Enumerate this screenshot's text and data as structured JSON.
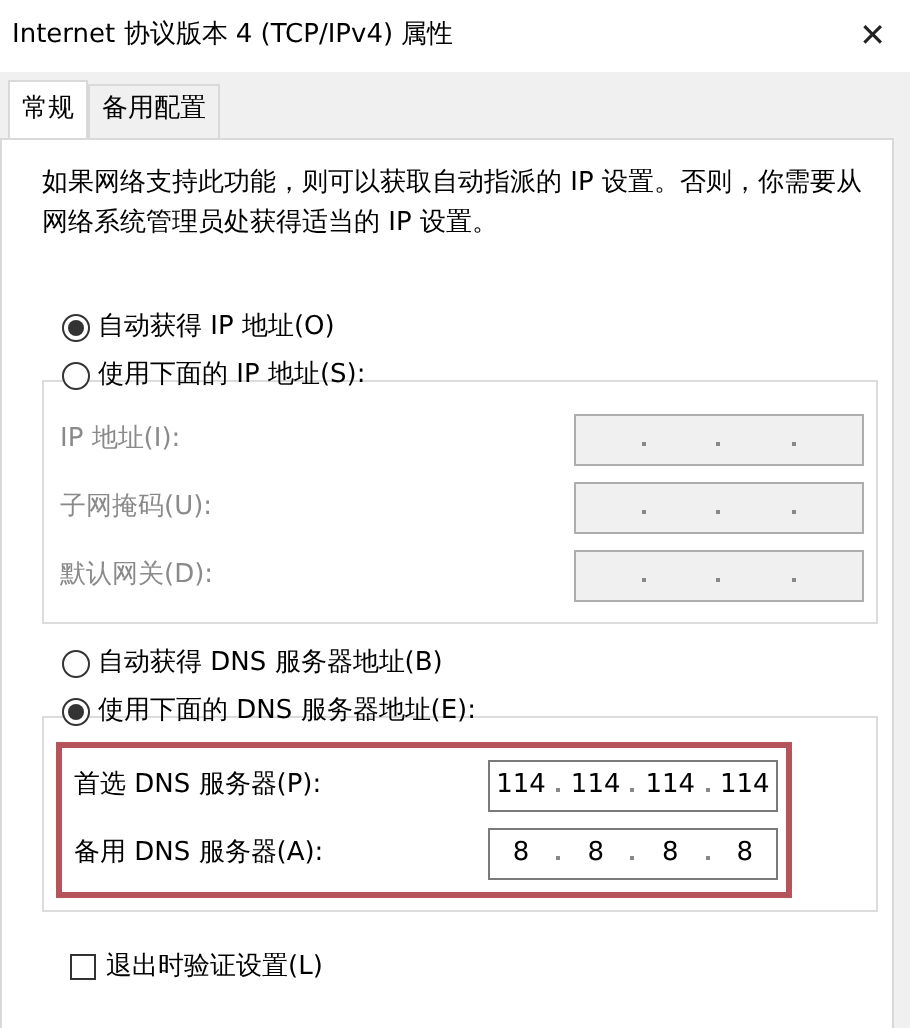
{
  "window": {
    "title": "Internet 协议版本 4 (TCP/IPv4) 属性",
    "close": "✕"
  },
  "tabs": [
    {
      "label": "常规",
      "selected": true
    },
    {
      "label": "备用配置",
      "selected": false
    }
  ],
  "description": "如果网络支持此功能，则可以获取自动指派的 IP 设置。否则，你需要从网络系统管理员处获得适当的 IP 设置。",
  "ip_options": [
    {
      "label": "自动获得 IP 地址(O)",
      "selected": true
    },
    {
      "label": "使用下面的 IP 地址(S):",
      "selected": false
    }
  ],
  "ip_fields": [
    {
      "label": "IP 地址(I):",
      "disabled": true
    },
    {
      "label": "子网掩码(U):",
      "disabled": true
    },
    {
      "label": "默认网关(D):",
      "disabled": true
    }
  ],
  "dns_options": [
    {
      "label": "自动获得 DNS 服务器地址(B)",
      "selected": false
    },
    {
      "label": "使用下面的 DNS 服务器地址(E):",
      "selected": true
    }
  ],
  "dns_highlighted": true,
  "dns_fields": [
    {
      "label": "首选 DNS 服务器(P):",
      "disabled": false,
      "octets": [
        "114",
        "114",
        "114",
        "114"
      ]
    },
    {
      "label": "备用 DNS 服务器(A):",
      "disabled": false,
      "octets": [
        "8",
        "8",
        "8",
        "8"
      ]
    }
  ],
  "validate": {
    "label": "退出时验证设置(L)",
    "checked": false
  }
}
